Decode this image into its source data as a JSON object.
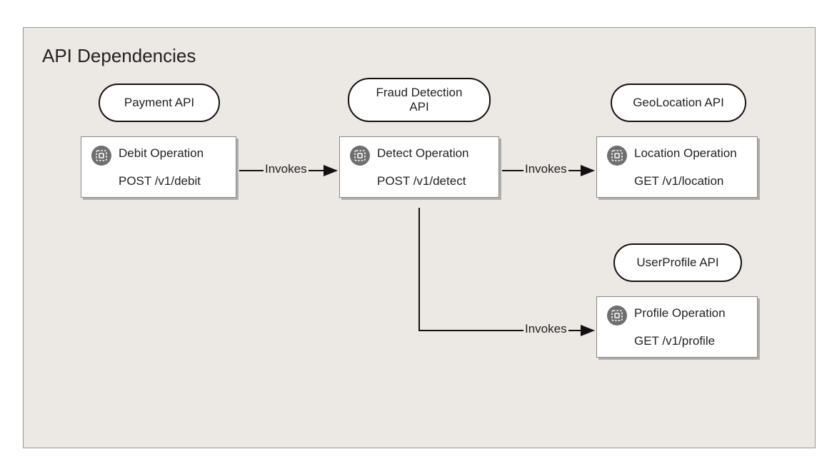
{
  "title": "API Dependencies",
  "apis": {
    "payment": {
      "label": "Payment API"
    },
    "fraud": {
      "label": "Fraud Detection API"
    },
    "geo": {
      "label": "GeoLocation API"
    },
    "user": {
      "label": "UserProfile API"
    }
  },
  "operations": {
    "debit": {
      "title": "Debit Operation",
      "path": "POST /v1/debit"
    },
    "detect": {
      "title": "Detect Operation",
      "path": "POST /v1/detect"
    },
    "location": {
      "title": "Location Operation",
      "path": "GET /v1/location"
    },
    "profile": {
      "title": "Profile Operation",
      "path": "GET /v1/profile"
    }
  },
  "edges": {
    "e1": "Invokes",
    "e2": "Invokes",
    "e3": "Invokes"
  }
}
